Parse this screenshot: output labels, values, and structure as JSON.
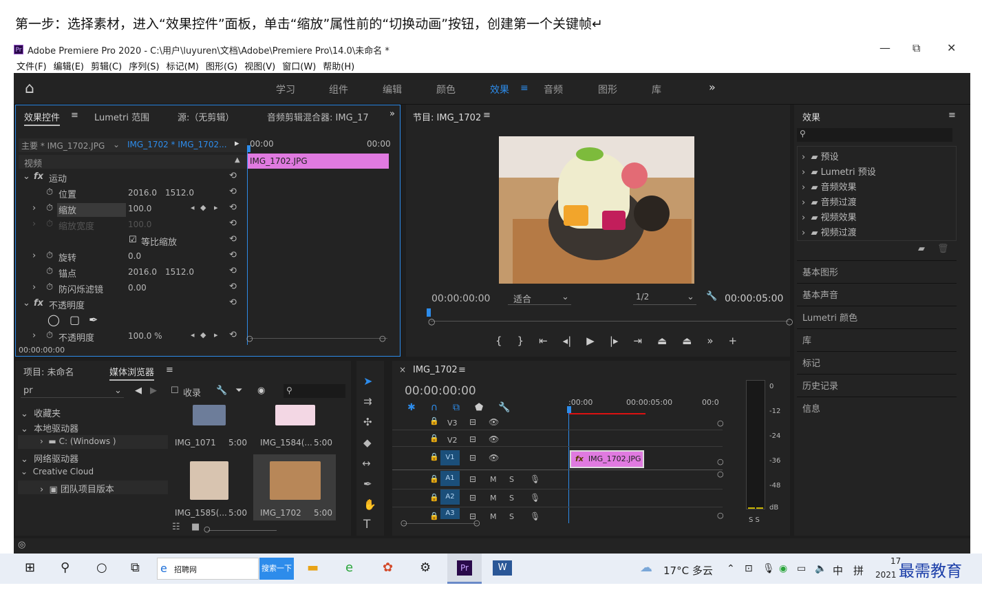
{
  "instruction": "第一步：选择素材，进入“效果控件”面板，单击“缩放”属性前的“切换动画”按钮，创建第一个关键帧↵",
  "window": {
    "title": "Adobe Premiere Pro 2020 - C:\\用户\\luyuren\\文档\\Adobe\\Premiere Pro\\14.0\\未命名 *",
    "logo": "Pr",
    "minimize": "—",
    "restore": "⧉",
    "close": "✕"
  },
  "menu": [
    "文件(F)",
    "编辑(E)",
    "剪辑(C)",
    "序列(S)",
    "标记(M)",
    "图形(G)",
    "视图(V)",
    "窗口(W)",
    "帮助(H)"
  ],
  "workspaces": {
    "home": "⌂",
    "tabs": [
      "学习",
      "组件",
      "编辑",
      "颜色",
      "效果",
      "音频",
      "图形",
      "库"
    ],
    "active": "效果",
    "more": "»"
  },
  "effect_controls": {
    "tabs": [
      "效果控件",
      "Lumetri 范围",
      "源:（无剪辑）",
      "音频剪辑混合器: IMG_17"
    ],
    "master": "主要 * IMG_1702.JPG",
    "sequence": "IMG_1702 * IMG_1702...",
    "time_start": "00:00",
    "time_end": "00:00",
    "clip": "IMG_1702.JPG",
    "video_label": "视频",
    "motion": "运动",
    "position": "位置",
    "pos_x": "2016.0",
    "pos_y": "1512.0",
    "scale": "缩放",
    "scale_val": "100.0",
    "scale_width": "缩放宽度",
    "scale_width_val": "100.0",
    "uniform": "等比缩放",
    "rotation": "旋转",
    "rotation_val": "0.0",
    "anchor": "锚点",
    "anchor_x": "2016.0",
    "anchor_y": "1512.0",
    "flicker": "防闪烁滤镜",
    "flicker_val": "0.00",
    "opacity_group": "不透明度",
    "opacity": "不透明度",
    "opacity_val": "100.0 %",
    "timecode": "00:00:00:00"
  },
  "program": {
    "title": "节目: IMG_1702",
    "timecode": "00:00:00:00",
    "fit": "适合",
    "quality": "1/2",
    "duration": "00:00:05:00"
  },
  "effects": {
    "title": "效果",
    "items": [
      "预设",
      "Lumetri 预设",
      "音频效果",
      "音频过渡",
      "视频效果",
      "视频过渡"
    ],
    "sections": [
      "基本图形",
      "基本声音",
      "Lumetri 颜色",
      "库",
      "标记",
      "历史记录",
      "信息"
    ]
  },
  "project": {
    "tabs": [
      "项目: 未命名",
      "媒体浏览器"
    ],
    "path": "pr",
    "collect": "收录",
    "tree": [
      "收藏夹",
      "本地驱动器",
      "C: (Windows )",
      "网络驱动器",
      "Creative Cloud",
      "团队项目版本"
    ],
    "media": [
      {
        "name": "IMG_1071",
        "dur": "5:00"
      },
      {
        "name": "IMG_1584(...",
        "dur": "5:00"
      },
      {
        "name": "IMG_1585(...",
        "dur": "5:00"
      },
      {
        "name": "IMG_1702",
        "dur": "5:00"
      }
    ]
  },
  "timeline": {
    "title": "IMG_1702",
    "timecode": "00:00:00:00",
    "ruler": [
      ":00:00",
      "00:00:05:00",
      "00:0"
    ],
    "tracks": [
      "V3",
      "V2",
      "V1",
      "A1",
      "A2",
      "A3"
    ],
    "clip": "IMG_1702.JPG",
    "m": "M",
    "s": "S"
  },
  "meter": {
    "labels": [
      "0",
      "-12",
      "-24",
      "-36",
      "-48",
      "dB"
    ],
    "ss": "S S"
  },
  "taskbar": {
    "search_label": "招聘网",
    "search_btn": "搜索一下",
    "weather": "17°C 多云",
    "ime1": "中",
    "ime2": "拼",
    "time": "17",
    "date": "2021",
    "watermark": "最需教育"
  }
}
